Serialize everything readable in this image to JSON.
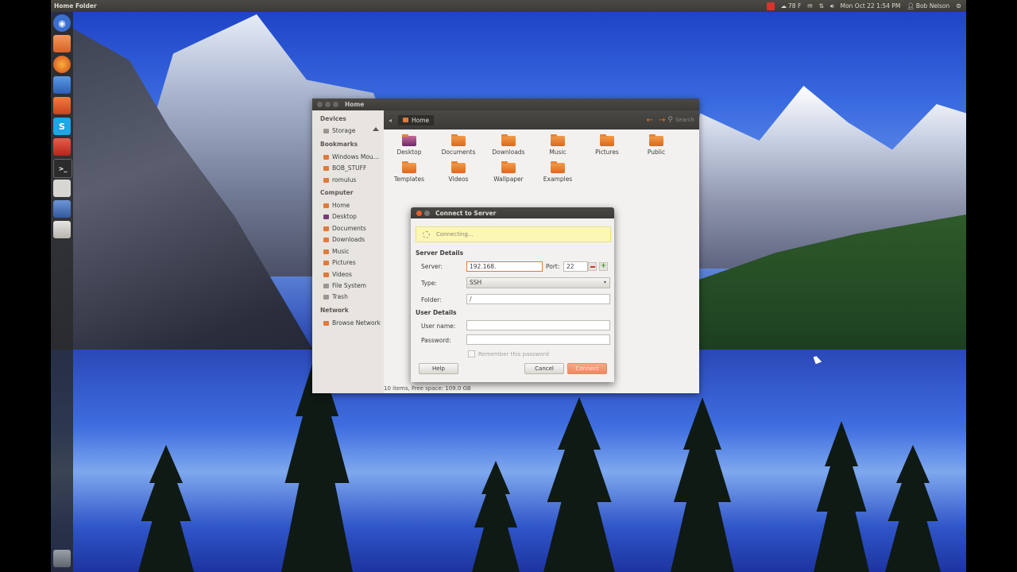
{
  "panel": {
    "app_title": "Home Folder",
    "weather": "78 F",
    "datetime": "Mon Oct 22  1:54 PM",
    "user": "Bob Nelson"
  },
  "launcher": {
    "items": [
      "dash-icon",
      "files-icon",
      "firefox-icon",
      "thunderbird-icon",
      "software-center-icon",
      "skype-icon",
      "settings-icon",
      "terminal-icon",
      "calculator-icon",
      "remmina-icon",
      "drive-icon",
      "trash-icon"
    ]
  },
  "file_manager": {
    "title": "Home",
    "location": "Home",
    "search_placeholder": "Search",
    "status": "10 items, Free space: 109.0 GB",
    "sidebar": {
      "devices_header": "Devices",
      "devices": [
        "Storage"
      ],
      "bookmarks_header": "Bookmarks",
      "bookmarks": [
        "Windows Mou...",
        "BOB_STUFF",
        "romulus"
      ],
      "computer_header": "Computer",
      "computer": [
        "Home",
        "Desktop",
        "Documents",
        "Downloads",
        "Music",
        "Pictures",
        "Videos",
        "File System",
        "Trash"
      ],
      "network_header": "Network",
      "network": [
        "Browse Network"
      ]
    },
    "folders": [
      "Desktop",
      "Documents",
      "Downloads",
      "Music",
      "Pictures",
      "Public",
      "Templates",
      "Videos",
      "Wallpaper",
      "Examples"
    ]
  },
  "dialog": {
    "title": "Connect to Server",
    "status": "Connecting...",
    "server_details_header": "Server Details",
    "server_label": "Server:",
    "server_value": "192.168.",
    "port_label": "Port:",
    "port_value": "22",
    "type_label": "Type:",
    "type_value": "SSH",
    "folder_label": "Folder:",
    "folder_value": "/",
    "user_details_header": "User Details",
    "username_label": "User name:",
    "username_value": "",
    "password_label": "Password:",
    "password_value": "",
    "remember_label": "Remember this password",
    "help_label": "Help",
    "cancel_label": "Cancel",
    "connect_label": "Connect"
  },
  "colors": {
    "accent": "#dd4814",
    "panel": "#3c3b37",
    "connecting_bg": "#fcf7b5"
  }
}
